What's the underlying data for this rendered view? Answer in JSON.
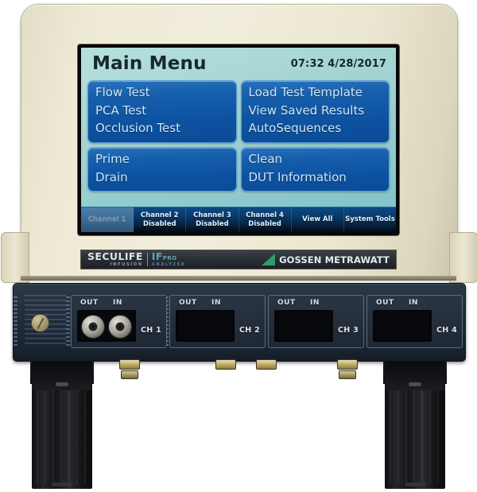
{
  "device": {
    "name": "SECULIFE IF PRO Infusion Analyzer",
    "case_color": "#ece7d1",
    "panel_color": "#222c3a"
  },
  "screen": {
    "title": "Main Menu",
    "clock": "07:32 4/28/2017",
    "background_color": "#a3d4d2",
    "button_color": "#0d53a2",
    "button_text_color": "#cfe6f7",
    "menu_groups": [
      {
        "items": [
          "Flow Test",
          "PCA Test",
          "Occlusion Test"
        ]
      },
      {
        "items": [
          "Load Test Template",
          "View Saved Results",
          "AutoSequences"
        ]
      },
      {
        "items": [
          "Prime",
          "Drain"
        ]
      },
      {
        "items": [
          "Clean",
          "DUT Information"
        ]
      }
    ],
    "tabs": [
      {
        "label": "Channel 1",
        "sub": "",
        "active": true
      },
      {
        "label": "Channel 2",
        "sub": "Disabled",
        "active": false
      },
      {
        "label": "Channel 3",
        "sub": "Disabled",
        "active": false
      },
      {
        "label": "Channel 4",
        "sub": "Disabled",
        "active": false
      },
      {
        "label": "View All",
        "sub": "",
        "active": false
      },
      {
        "label": "System Tools",
        "sub": "",
        "active": false
      }
    ]
  },
  "brand_plate": {
    "product_main": "SECULIFE",
    "product_sub": "INFUSION",
    "model_main": "IF",
    "model_pro": "PRO",
    "model_sub": "ANALYZER",
    "manufacturer": "GOSSEN METRAWATT",
    "manufacturer_mark_color": "#2e9e6b"
  },
  "connector_panel": {
    "label_out": "OUT",
    "label_in": "IN",
    "channels": [
      {
        "name": "CH 1",
        "populated": true
      },
      {
        "name": "CH 2",
        "populated": false
      },
      {
        "name": "CH 3",
        "populated": false
      },
      {
        "name": "CH 4",
        "populated": false
      }
    ]
  }
}
